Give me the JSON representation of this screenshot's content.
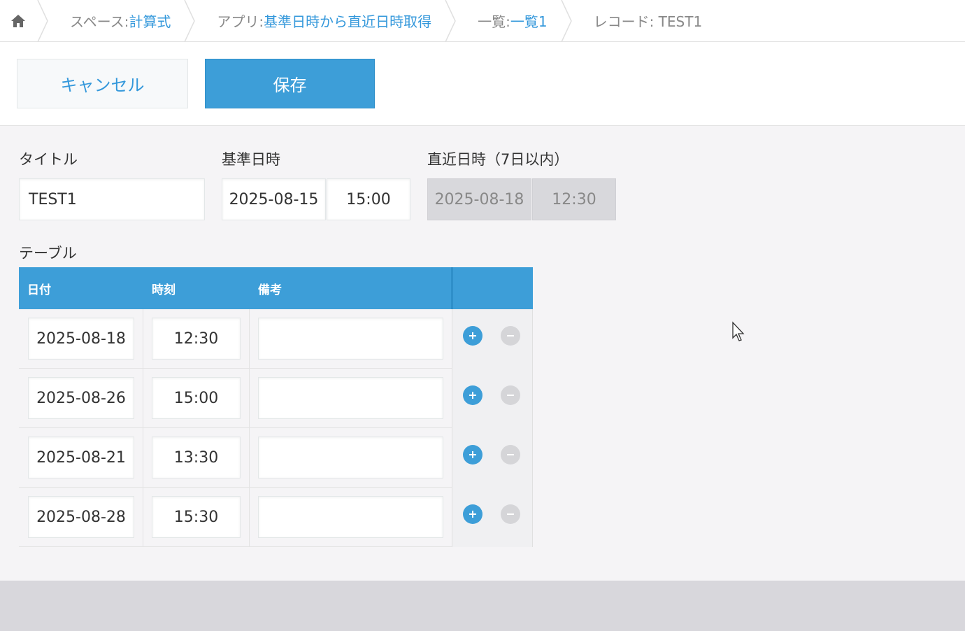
{
  "breadcrumb": {
    "home_icon": "home-icon",
    "space_prefix": "スペース: ",
    "space_name": "計算式",
    "app_prefix": "アプリ: ",
    "app_name": "基準日時から直近日時取得",
    "view_prefix": "一覧: ",
    "view_name": "一覧1",
    "record_label": "レコード: TEST1"
  },
  "toolbar": {
    "cancel_label": "キャンセル",
    "save_label": "保存"
  },
  "form": {
    "title_label": "タイトル",
    "title_value": "TEST1",
    "base_label": "基準日時",
    "base_date": "2025-08-15",
    "base_time": "15:00",
    "nearest_label": "直近日時（7日以内）",
    "nearest_date": "2025-08-18",
    "nearest_time": "12:30",
    "table_label": "テーブル"
  },
  "table": {
    "headers": [
      "日付",
      "時刻",
      "備考"
    ],
    "rows": [
      {
        "date": "2025-08-18",
        "time": "12:30",
        "note": ""
      },
      {
        "date": "2025-08-26",
        "time": "15:00",
        "note": ""
      },
      {
        "date": "2025-08-21",
        "time": "13:30",
        "note": ""
      },
      {
        "date": "2025-08-28",
        "time": "15:30",
        "note": ""
      }
    ],
    "add_icon": "plus-circle-icon",
    "remove_icon": "minus-circle-icon"
  },
  "colors": {
    "accent": "#3d9ed8",
    "link": "#3498db",
    "readonly_bg": "#d8d8dc",
    "page_bg": "#f5f4f6"
  }
}
